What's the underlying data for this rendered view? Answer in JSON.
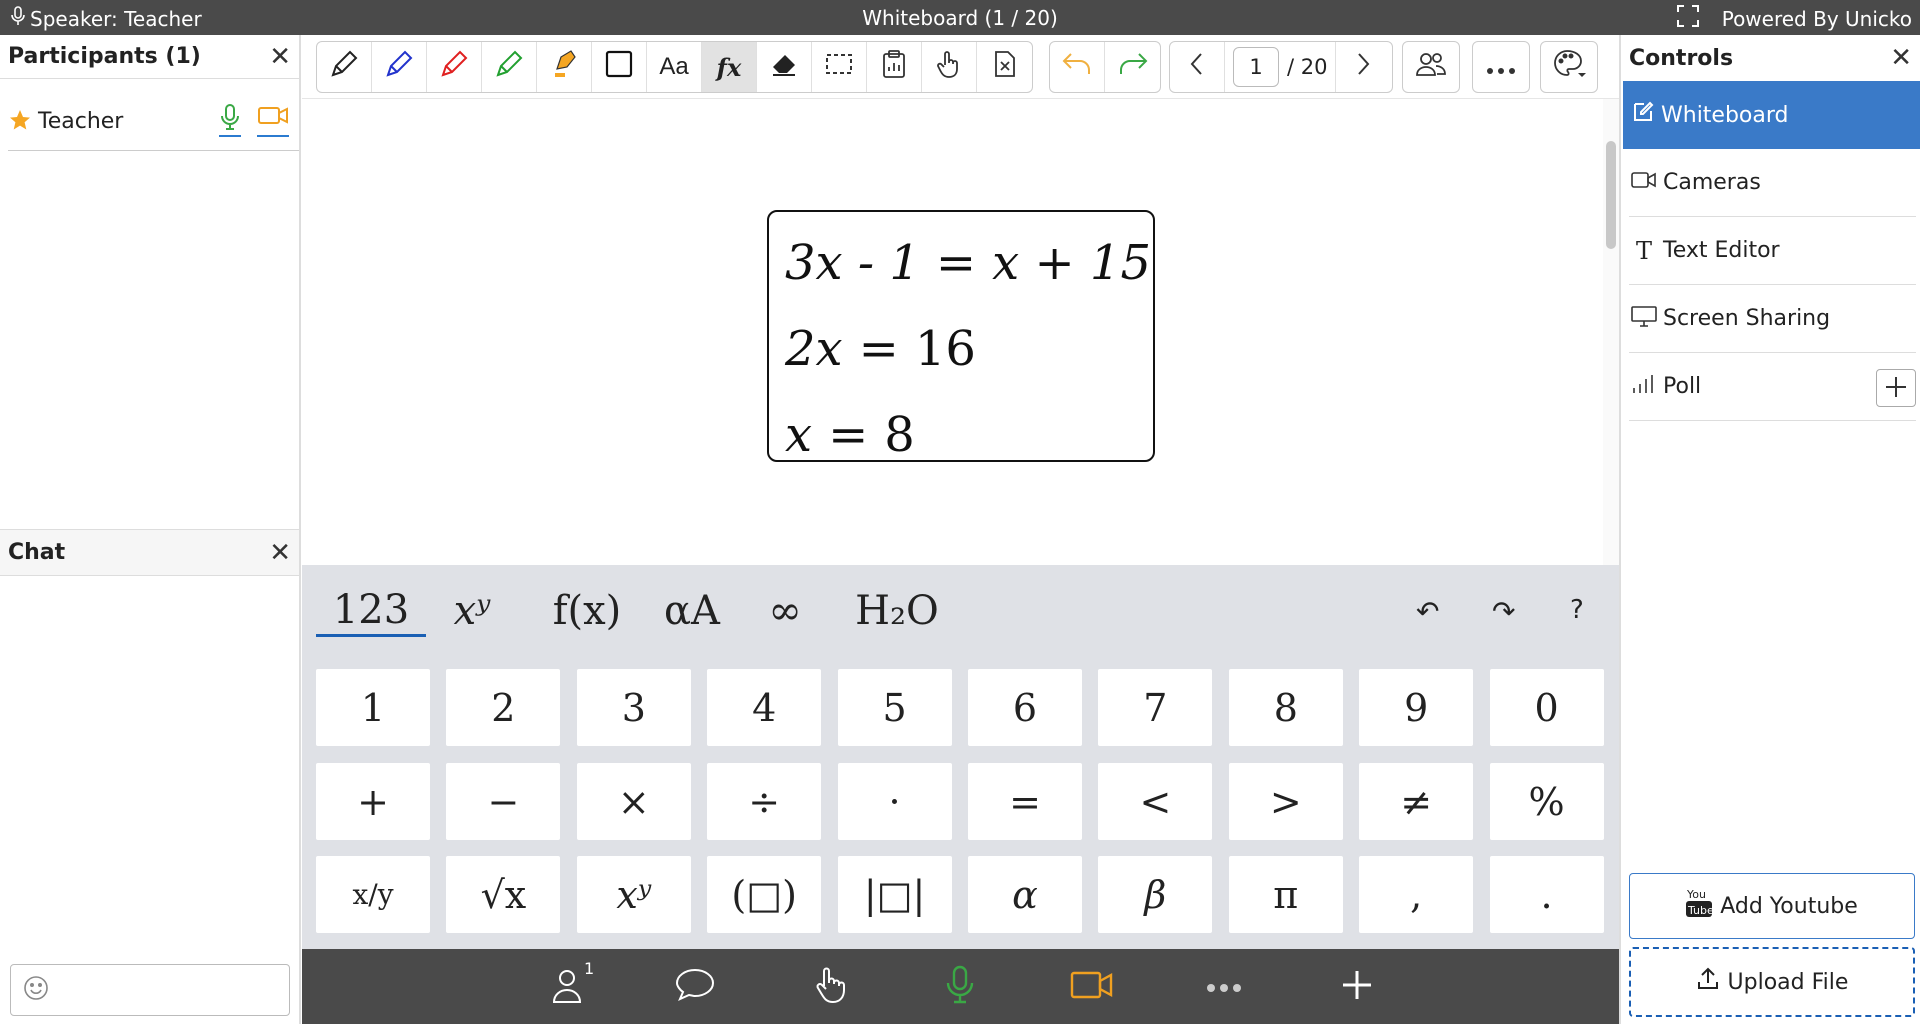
{
  "topbar": {
    "speaker": "Speaker: Teacher",
    "title": "Whiteboard (1 / 20)",
    "powered": "Powered By Unicko"
  },
  "participants": {
    "title": "Participants (1)",
    "list": [
      {
        "name": "Teacher"
      }
    ]
  },
  "chat": {
    "title": "Chat"
  },
  "toolbar": {
    "text_tool": "Aa",
    "formula_tool": "fx",
    "page_current": "1",
    "page_total": "/ 20"
  },
  "whiteboard": {
    "equations": [
      {
        "lhs": "3x - 1",
        "rhs": "x + 15"
      },
      {
        "lhs": "2x",
        "rhs": "16"
      },
      {
        "lhs": "x",
        "rhs": "8"
      }
    ],
    "equals": "="
  },
  "keyboard": {
    "tabs": [
      "123",
      "xʸ",
      "f(x)",
      "αA",
      "∞",
      "H₂O"
    ],
    "util": {
      "undo": "↶",
      "redo": "↷",
      "help": "?"
    },
    "rows": [
      [
        "1",
        "2",
        "3",
        "4",
        "5",
        "6",
        "7",
        "8",
        "9",
        "0"
      ],
      [
        "+",
        "−",
        "×",
        "÷",
        "·",
        "=",
        "<",
        ">",
        "≠",
        "%"
      ],
      [
        "x/y",
        "√x",
        "xʸ",
        "(□)",
        "|□|",
        "α",
        "β",
        "π",
        ",",
        "."
      ]
    ]
  },
  "bottombar": {
    "participants_count": "1"
  },
  "controls": {
    "title": "Controls",
    "items": [
      "Whiteboard",
      "Cameras",
      "Text Editor",
      "Screen Sharing",
      "Poll"
    ],
    "add_youtube": "Add Youtube",
    "upload_file": "Upload File"
  },
  "colors": {
    "topbar_bg": "#4a4a4a",
    "accent_blue": "#3a7ac8",
    "mic_green": "#3aa845",
    "cam_orange": "#f0a020",
    "undo_orange": "#f0b040",
    "redo_green": "#3aa845",
    "keyboard_bg": "#dfe1e6"
  }
}
